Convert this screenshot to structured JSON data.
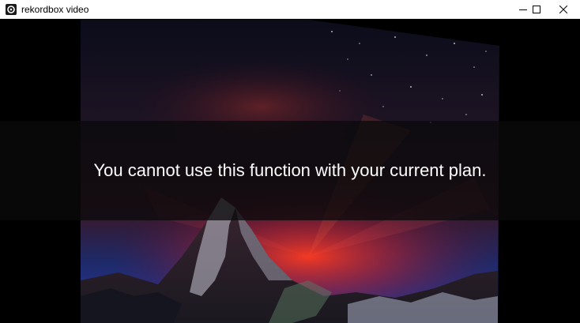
{
  "window": {
    "title": "rekordbox video",
    "icon": "rekordbox-logo-icon",
    "controls": [
      "minimize-icon",
      "maximize-icon",
      "close-icon"
    ]
  },
  "notice": {
    "message": "You cannot use this function with your current plan."
  },
  "colors": {
    "titlebar_bg": "#ffffff",
    "content_bg": "#000000",
    "text": "#ffffff"
  }
}
